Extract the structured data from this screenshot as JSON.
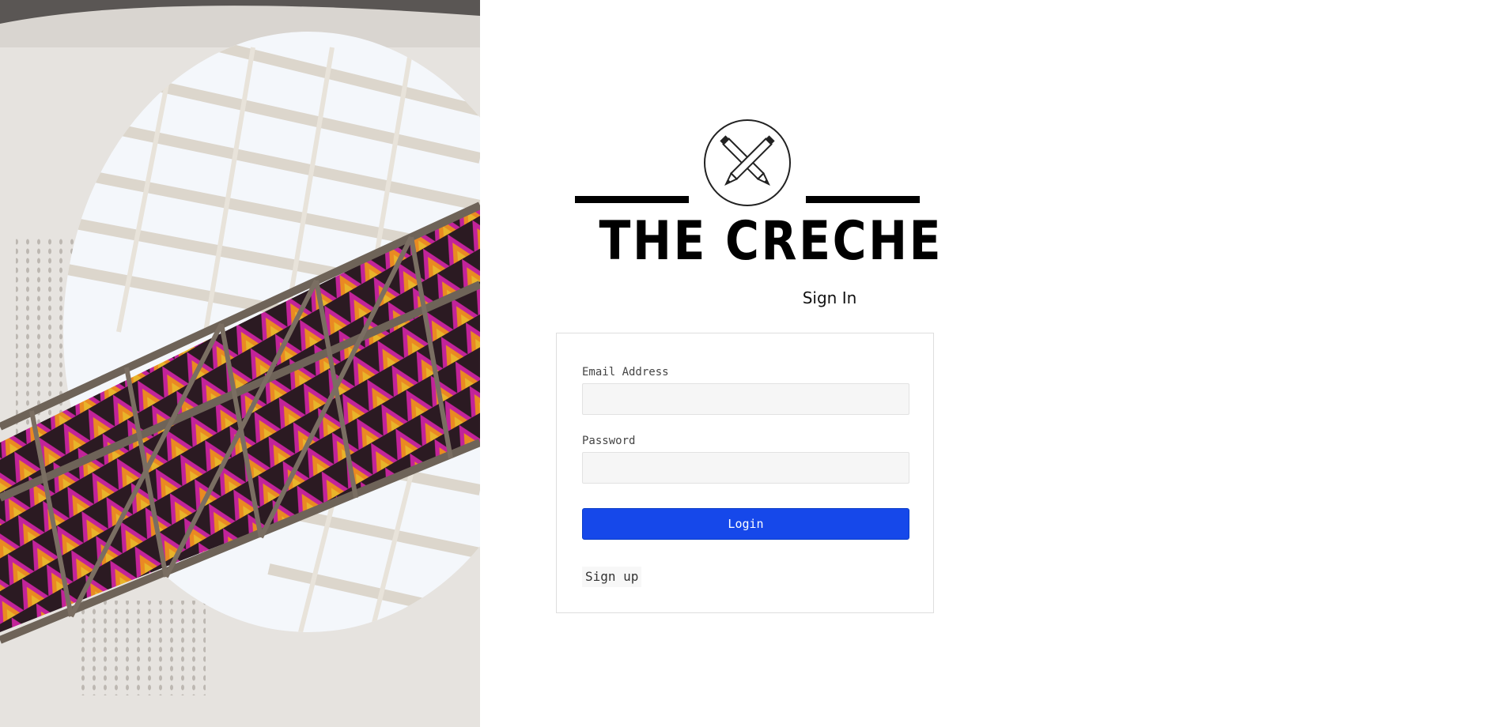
{
  "hero": {
    "image": "architectural-skylight-with-colorful-staircase",
    "colors": {
      "wall": "#e6e3df",
      "sky": "#f4f7fb",
      "beam": "#dcd6cc",
      "truss": "#6e6358",
      "accent_magenta": "#c2239a",
      "accent_orange": "#e98a22",
      "accent_gold": "#e8b42a"
    }
  },
  "brand": {
    "name": "THE CRECHE",
    "logo_icon": "crossed-pencils-icon"
  },
  "form": {
    "title": "Sign In",
    "email_label": "Email Address",
    "email_value": "",
    "email_placeholder": "",
    "password_label": "Password",
    "password_value": "",
    "password_placeholder": "",
    "login_label": "Login",
    "signup_label": "Sign up"
  },
  "colors": {
    "primary": "#1648ea",
    "input_bg": "#f6f6f6",
    "border": "#dedede"
  }
}
